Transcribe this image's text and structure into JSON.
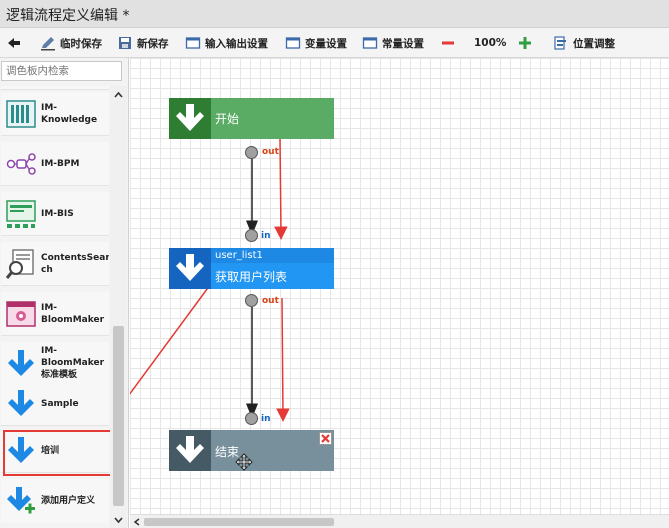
{
  "window": {
    "title": "逻辑流程定义编辑 *"
  },
  "toolbar": {
    "temp_save": "临时保存",
    "new_save": "新保存",
    "io_settings": "输入输出设置",
    "var_settings": "变量设置",
    "const_settings": "常量设置",
    "zoom": "100%",
    "position_adjust": "位置调整"
  },
  "sidebar": {
    "search_placeholder": "调色板内检索",
    "items": [
      {
        "label": "IM-\nKnowledge",
        "icon": "knowledge-icon"
      },
      {
        "label": "IM-BPM",
        "icon": "bpm-icon"
      },
      {
        "label": "IM-BIS",
        "icon": "bis-icon"
      },
      {
        "label": "ContentsSear\nch",
        "icon": "contents-search-icon"
      },
      {
        "label": "IM-\nBloomMaker",
        "icon": "bloommaker-icon"
      },
      {
        "label": "IM-\nBloomMaker\n标准模板",
        "icon": "arrow-down-icon"
      },
      {
        "label": "Sample",
        "icon": "arrow-down-icon"
      },
      {
        "label": "培训",
        "icon": "arrow-down-icon"
      },
      {
        "label": "添加用户定义",
        "icon": "add-user-definition-icon"
      }
    ]
  },
  "flow": {
    "start": {
      "label": "开始"
    },
    "task": {
      "id": "user_list1",
      "label": "获取用户列表"
    },
    "end": {
      "label": "结束"
    },
    "ports": {
      "out": "out",
      "in": "in"
    }
  },
  "colors": {
    "start": "#5aab63",
    "start_icon": "#2e7d32",
    "task": "#2196f3",
    "task_icon": "#1565c0",
    "end": "#78909c",
    "end_icon": "#455a64",
    "annotation": "#e53935",
    "palette_arrow": "#1e88e5"
  }
}
